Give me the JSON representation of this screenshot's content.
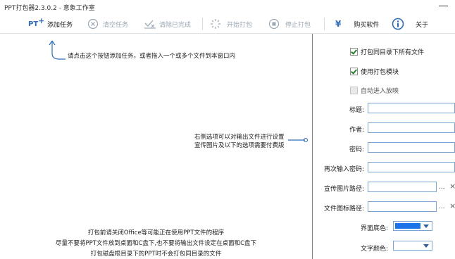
{
  "window": {
    "title": "PPT打包器2.3.0.2 - 意象工作室"
  },
  "toolbar": {
    "add_badge": "PT",
    "add": "添加任务",
    "clear": "清空任务",
    "clear_done": "清除已完成",
    "start": "开始打包",
    "stop": "停止打包",
    "buy_icon": "¥",
    "buy": "购买软件",
    "about": "关于"
  },
  "left": {
    "hint_add": "请点击这个按钮添加任务，或者拖入一个或多个文件到本窗口内",
    "hint_right_1": "右侧选项可以对输出文件进行设置",
    "hint_right_2": "宣传图片及以下的选项需要付费版",
    "notes": [
      "打包前请关闭Office等可能正在使用PPT文件的程序",
      "尽量不要将PPT文件放到桌面和C盘下,也不要将输出文件设定在桌面和C盘下",
      "打包磁盘根目录下的PPT时不会打包同目录的文件"
    ]
  },
  "options": {
    "pack_all": {
      "label": "打包同目录下所有文件",
      "checked": true
    },
    "use_module": {
      "label": "使用打包模块",
      "checked": true
    },
    "auto_play": {
      "label": "自动进入放映",
      "checked": false,
      "enabled": false
    },
    "title_label": "标题:",
    "author_label": "作者:",
    "password_label": "密码:",
    "password2_label": "再次输入密码:",
    "promo_label": "宣传图片路径:",
    "icon_label": "文件图标路径:",
    "browse": "...",
    "remove": "×",
    "bg_color_label": "界面底色:",
    "text_color_label": "文字颜色:",
    "bg_color": "#1a73e8",
    "accent": "#2f6db5"
  }
}
